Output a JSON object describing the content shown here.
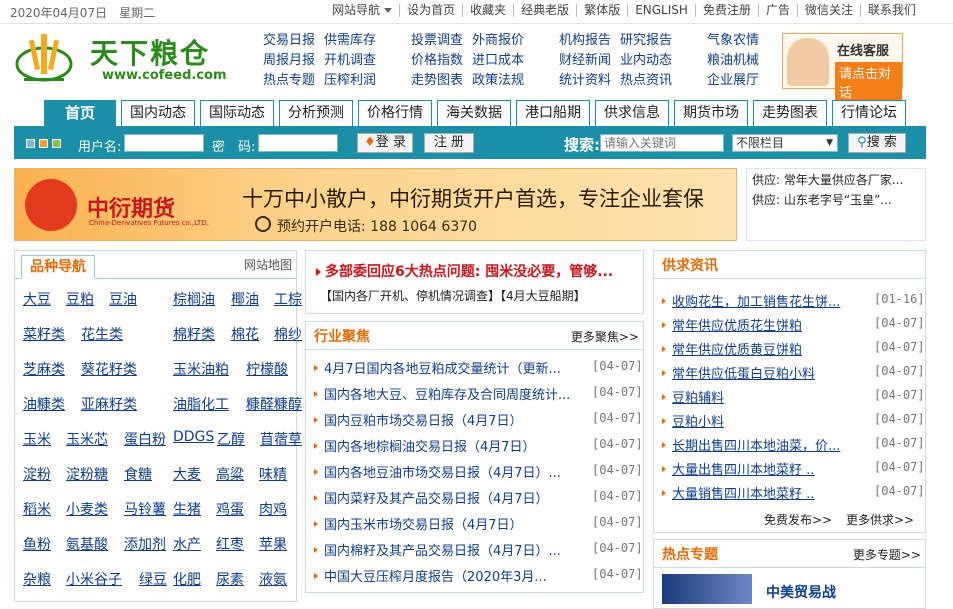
{
  "topbar": {
    "date": "2020年04月07日",
    "weekday": "星期二",
    "links": [
      "网站导航",
      "设为首页",
      "收藏夹",
      "经典老版",
      "繁体版",
      "ENGLISH",
      "免费注册",
      "广告",
      "微信关注",
      "联系我们"
    ]
  },
  "logo": {
    "cn": "天下粮仓",
    "en": "www.cofeed.com"
  },
  "header_links": {
    "group1": [
      "交易日报",
      "供需库存",
      "周报月报",
      "开机调查",
      "热点专题",
      "压榨利润"
    ],
    "group2": [
      "投票调查",
      "外商报价",
      "价格指数",
      "进口成本",
      "走势图表",
      "政策法规"
    ],
    "group3": [
      "机构报告",
      "研究报告",
      "财经新闻",
      "业内动态",
      "统计资料",
      "热点资讯"
    ],
    "group4": [
      "气象农情",
      "粮油机械",
      "企业展厅"
    ]
  },
  "kefu": {
    "title": "在线客服",
    "button": "请点击对话"
  },
  "nav": [
    "首页",
    "国内动态",
    "国际动态",
    "分析预测",
    "价格行情",
    "海关数据",
    "港口船期",
    "供求信息",
    "期货市场",
    "走势图表",
    "行情论坛"
  ],
  "login": {
    "user_label": "用户名:",
    "pwd_label": "密　码:",
    "login_btn": "登 录",
    "register_btn": "注 册",
    "search_label": "搜索:",
    "search_placeholder": "请输入关键词",
    "select_value": "不限栏目",
    "search_btn": "搜 索"
  },
  "banner": {
    "brand": "中衍期货",
    "brand_en": "China-Derivatives Futures co.,LTD.",
    "slogan": "十万中小散户，中衍期货开户首选，专注企业套保",
    "phone": "预约开户电话: 188 1064 6370"
  },
  "supply_box": [
    "供应: 常年大量供应各厂家...",
    "供应: 山东老字号“玉皇”..."
  ],
  "categories": {
    "title": "品种导航",
    "map_link": "网站地图",
    "left": [
      [
        "大豆",
        "豆粕",
        "豆油"
      ],
      [
        "菜籽类",
        "花生类"
      ],
      [
        "芝麻类",
        "葵花籽类"
      ],
      [
        "油糠类",
        "亚麻籽类"
      ],
      [
        "玉米",
        "玉米芯",
        "蛋白粉"
      ],
      [
        "淀粉",
        "淀粉糖",
        "食糖"
      ],
      [
        "稻米",
        "小麦类",
        "马铃薯"
      ],
      [
        "鱼粉",
        "氨基酸",
        "添加剂"
      ],
      [
        "杂粮",
        "小米谷子",
        "绿豆"
      ]
    ],
    "right": [
      [
        "棕榈油",
        "椰油",
        "工棕"
      ],
      [
        "棉籽类",
        "棉花",
        "棉纱"
      ],
      [
        "玉米油粕",
        "柠檬酸"
      ],
      [
        "油脂化工",
        "糠醛糠醇"
      ],
      [
        "DDGS",
        "乙醇",
        "苜蓿草"
      ],
      [
        "大麦",
        "高粱",
        "味精"
      ],
      [
        "生猪",
        "鸡蛋",
        "肉鸡"
      ],
      [
        "水产",
        "红枣",
        "苹果"
      ],
      [
        "化肥",
        "尿素",
        "液氨"
      ]
    ]
  },
  "headline": {
    "title": "多部委回应6大热点问题: 囤米没必要，管够...",
    "sub": "【国内各厂开机、停机情况调查】【4月大豆船期】"
  },
  "industry": {
    "title": "行业聚焦",
    "more": "更多聚焦>>",
    "items": [
      {
        "t": "4月7日国内各地豆粕成交量统计（更新...",
        "d": "[04-07]"
      },
      {
        "t": "国内各地大豆、豆粕库存及合同周度统计...",
        "d": "[04-07]"
      },
      {
        "t": "国内豆粕市场交易日报（4月7日）",
        "d": "[04-07]"
      },
      {
        "t": "国内各地棕榈油交易日报（4月7日）",
        "d": "[04-07]"
      },
      {
        "t": "国内各地豆油市场交易日报（4月7日）...",
        "d": "[04-07]"
      },
      {
        "t": "国内菜籽及其产品交易日报（4月7日）",
        "d": "[04-07]"
      },
      {
        "t": "国内玉米市场交易日报（4月7日）",
        "d": "[04-07]"
      },
      {
        "t": "国内棉籽及其产品交易日报（4月7日）...",
        "d": "[04-07]"
      },
      {
        "t": "中国大豆压榨月度报告（2020年3月...",
        "d": "[04-07]"
      }
    ]
  },
  "supply": {
    "title": "供求资讯",
    "items": [
      {
        "t": "收购花生，加工销售花生饼...",
        "d": "[01-16]"
      },
      {
        "t": "常年供应优质花生饼粕",
        "d": "[04-07]"
      },
      {
        "t": "常年供应优质黄豆饼粕",
        "d": "[04-07]"
      },
      {
        "t": "常年供应低蛋白豆粕小料",
        "d": "[04-07]"
      },
      {
        "t": "豆粕辅料",
        "d": "[04-07]"
      },
      {
        "t": "豆粕小料",
        "d": "[04-07]"
      },
      {
        "t": "长期出售四川本地油菜，价...",
        "d": "[04-07]"
      },
      {
        "t": "大量出售四川本地菜籽 ..",
        "d": "[04-07]"
      },
      {
        "t": "大量销售四川本地菜籽 ..",
        "d": "[04-07]"
      }
    ],
    "free_post": "免费发布>>",
    "more": "更多供求>>"
  },
  "hot": {
    "title": "热点专题",
    "more": "更多专题>>",
    "first": "中美贸易战"
  },
  "colors": {
    "teal": "#1b8fa8",
    "orange": "#e36c0a",
    "link": "#0f3f8c",
    "green": "#2d8a1d"
  }
}
